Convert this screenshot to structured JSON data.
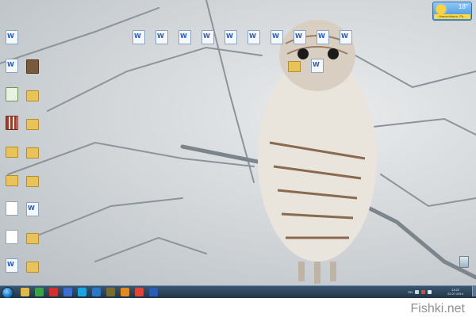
{
  "weather": {
    "temp": "18°",
    "city": "Новосибирск, Ру..."
  },
  "desktop": {
    "icons_left": [
      {
        "glyph": "doc"
      },
      {
        "glyph": "doc"
      },
      {
        "glyph": "sheet"
      },
      {
        "glyph": "grid"
      },
      {
        "glyph": "folder"
      },
      {
        "glyph": "folder"
      },
      {
        "glyph": "blank"
      },
      {
        "glyph": "blank"
      },
      {
        "glyph": "doc"
      }
    ],
    "icons_col2": [
      {
        "glyph": "app"
      },
      {
        "glyph": "folder"
      },
      {
        "glyph": "folder"
      },
      {
        "glyph": "folder"
      },
      {
        "glyph": "folder"
      },
      {
        "glyph": "doc"
      },
      {
        "glyph": "folder"
      },
      {
        "glyph": "folder"
      }
    ],
    "icons_top": [
      {
        "glyph": "doc"
      },
      {
        "glyph": "doc"
      },
      {
        "glyph": "doc"
      },
      {
        "glyph": "doc"
      },
      {
        "glyph": "doc"
      },
      {
        "glyph": "doc"
      },
      {
        "glyph": "doc"
      },
      {
        "glyph": "doc"
      },
      {
        "glyph": "doc"
      },
      {
        "glyph": "doc"
      }
    ],
    "icons_second_row": [
      {
        "glyph": "folder"
      },
      {
        "glyph": "doc"
      }
    ],
    "recycle_label": ""
  },
  "taskbar": {
    "pinned": [
      {
        "name": "explorer-icon",
        "color": "#e1b94a"
      },
      {
        "name": "utorrent-icon",
        "color": "#3aa34a"
      },
      {
        "name": "opera-icon",
        "color": "#d2322d"
      },
      {
        "name": "media-icon",
        "color": "#3b6fd1"
      },
      {
        "name": "skype-icon",
        "color": "#1aa4e4"
      },
      {
        "name": "ccleaner-icon",
        "color": "#2b78c9"
      },
      {
        "name": "game-icon",
        "color": "#7b6b2e"
      },
      {
        "name": "player-icon",
        "color": "#e08a1f"
      },
      {
        "name": "chrome-icon",
        "color": "#e0453a"
      },
      {
        "name": "word-icon",
        "color": "#2a5bb5"
      }
    ],
    "lang": "EN",
    "time": "13:22",
    "date": "22.07.2014"
  },
  "watermark": "Fishki.net"
}
